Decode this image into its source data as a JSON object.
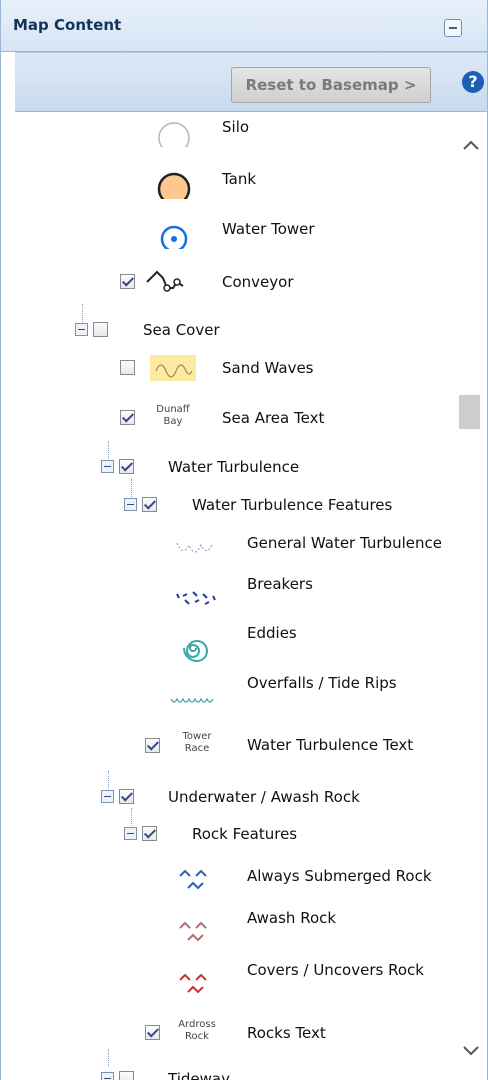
{
  "panel": {
    "title": "Map Content",
    "reset_label": "Reset to Basemap >",
    "help_label": "?"
  },
  "tree": {
    "silo": "Silo",
    "tank": "Tank",
    "water_tower": "Water Tower",
    "conveyor": "Conveyor",
    "sea_cover": "Sea Cover",
    "sand_waves": "Sand Waves",
    "sea_area_text": "Sea Area Text",
    "sea_area_sample": "Dunaff\nBay",
    "water_turbulence": "Water Turbulence",
    "water_turbulence_features": "Water Turbulence Features",
    "general_water_turbulence": "General Water Turbulence",
    "breakers": "Breakers",
    "eddies": "Eddies",
    "overfalls": "Overfalls / Tide Rips",
    "water_turbulence_text": "Water Turbulence Text",
    "water_turbulence_sample": "Tower\nRace",
    "underwater_rock": "Underwater / Awash Rock",
    "rock_features": "Rock Features",
    "always_submerged_rock": "Always Submerged Rock",
    "awash_rock": "Awash Rock",
    "covers_uncovers_rock": "Covers / Uncovers Rock",
    "rocks_text": "Rocks Text",
    "rocks_sample": "Ardross\nRock",
    "tideway": "Tideway"
  },
  "colors": {
    "tank_fill": "#fcc88f",
    "water_tower_blue": "#1a6fe0",
    "sand_waves_fill": "#fbeaa0",
    "turbulence_blue": "#1f3f9a",
    "eddy_teal": "#3aa6a6",
    "rock_blue": "#2f5fb0",
    "rock_brown": "#b07070",
    "rock_red": "#c8323a"
  },
  "scroll": {
    "position": 0.3
  }
}
